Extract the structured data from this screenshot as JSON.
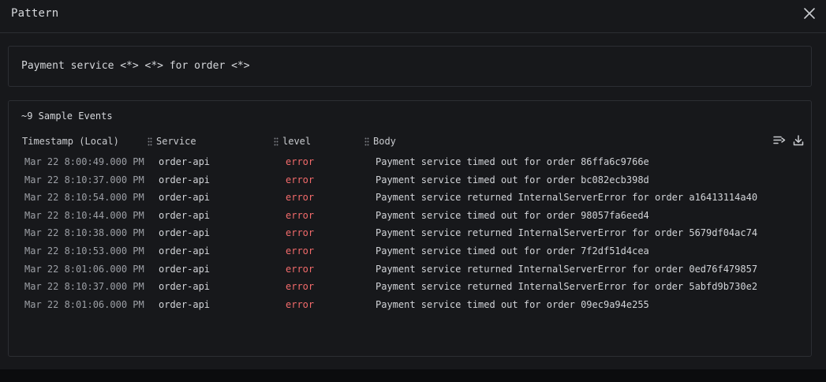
{
  "modal": {
    "title": "Pattern"
  },
  "pattern": {
    "text": "Payment service <*> <*> for order <*>"
  },
  "events": {
    "title": "~9 Sample Events",
    "columns": [
      "Timestamp (Local)",
      "Service",
      "level",
      "Body"
    ],
    "level_color": "#f36b6b",
    "rows": [
      {
        "timestamp": "Mar 22 8:00:49.000 PM",
        "service": "order-api",
        "level": "error",
        "body": "Payment service timed out for order 86ffa6c9766e"
      },
      {
        "timestamp": "Mar 22 8:10:37.000 PM",
        "service": "order-api",
        "level": "error",
        "body": "Payment service timed out for order bc082ecb398d"
      },
      {
        "timestamp": "Mar 22 8:10:54.000 PM",
        "service": "order-api",
        "level": "error",
        "body": "Payment service returned InternalServerError for order a16413114a40"
      },
      {
        "timestamp": "Mar 22 8:10:44.000 PM",
        "service": "order-api",
        "level": "error",
        "body": "Payment service timed out for order 98057fa6eed4"
      },
      {
        "timestamp": "Mar 22 8:10:38.000 PM",
        "service": "order-api",
        "level": "error",
        "body": "Payment service returned InternalServerError for order 5679df04ac74"
      },
      {
        "timestamp": "Mar 22 8:10:53.000 PM",
        "service": "order-api",
        "level": "error",
        "body": "Payment service timed out for order 7f2df51d4cea"
      },
      {
        "timestamp": "Mar 22 8:01:06.000 PM",
        "service": "order-api",
        "level": "error",
        "body": "Payment service returned InternalServerError for order 0ed76f479857"
      },
      {
        "timestamp": "Mar 22 8:10:37.000 PM",
        "service": "order-api",
        "level": "error",
        "body": "Payment service returned InternalServerError for order 5abfd9b730e2"
      },
      {
        "timestamp": "Mar 22 8:01:06.000 PM",
        "service": "order-api",
        "level": "error",
        "body": "Payment service timed out for order 09ec9a94e255"
      }
    ]
  },
  "icons": {
    "close": "close-icon",
    "wrap": "wrap-lines-icon",
    "download": "download-icon",
    "drag": "drag-handle-icon"
  }
}
